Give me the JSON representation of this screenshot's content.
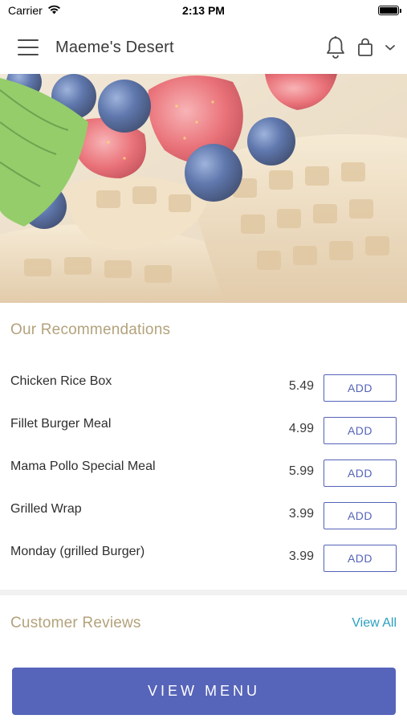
{
  "status_bar": {
    "carrier": "Carrier",
    "time": "2:13 PM",
    "battery_level": 1.0
  },
  "header": {
    "title": "Maeme's Desert",
    "menu_icon": "hamburger-icon",
    "notification_icon": "bell-icon",
    "cart_icon": "shopping-bag-icon",
    "dropdown_icon": "chevron-down-icon"
  },
  "hero": {
    "image_subject": "waffles-with-strawberries-and-blueberries"
  },
  "recommendations": {
    "title": "Our Recommendations",
    "items": [
      {
        "name": "Chicken Rice Box",
        "price": "5.49",
        "button": "ADD"
      },
      {
        "name": "Fillet Burger Meal",
        "price": "4.99",
        "button": "ADD"
      },
      {
        "name": "Mama Pollo Special Meal",
        "price": "5.99",
        "button": "ADD"
      },
      {
        "name": "Grilled Wrap",
        "price": "3.99",
        "button": "ADD"
      },
      {
        "name": "Monday (grilled Burger)",
        "price": "3.99",
        "button": "ADD"
      }
    ]
  },
  "reviews": {
    "title": "Customer Reviews",
    "view_all": "View All"
  },
  "footer": {
    "view_menu": "VIEW MENU"
  },
  "colors": {
    "accent": "#5664b9",
    "section_title": "#b3a27c",
    "link": "#2a9fc1"
  }
}
